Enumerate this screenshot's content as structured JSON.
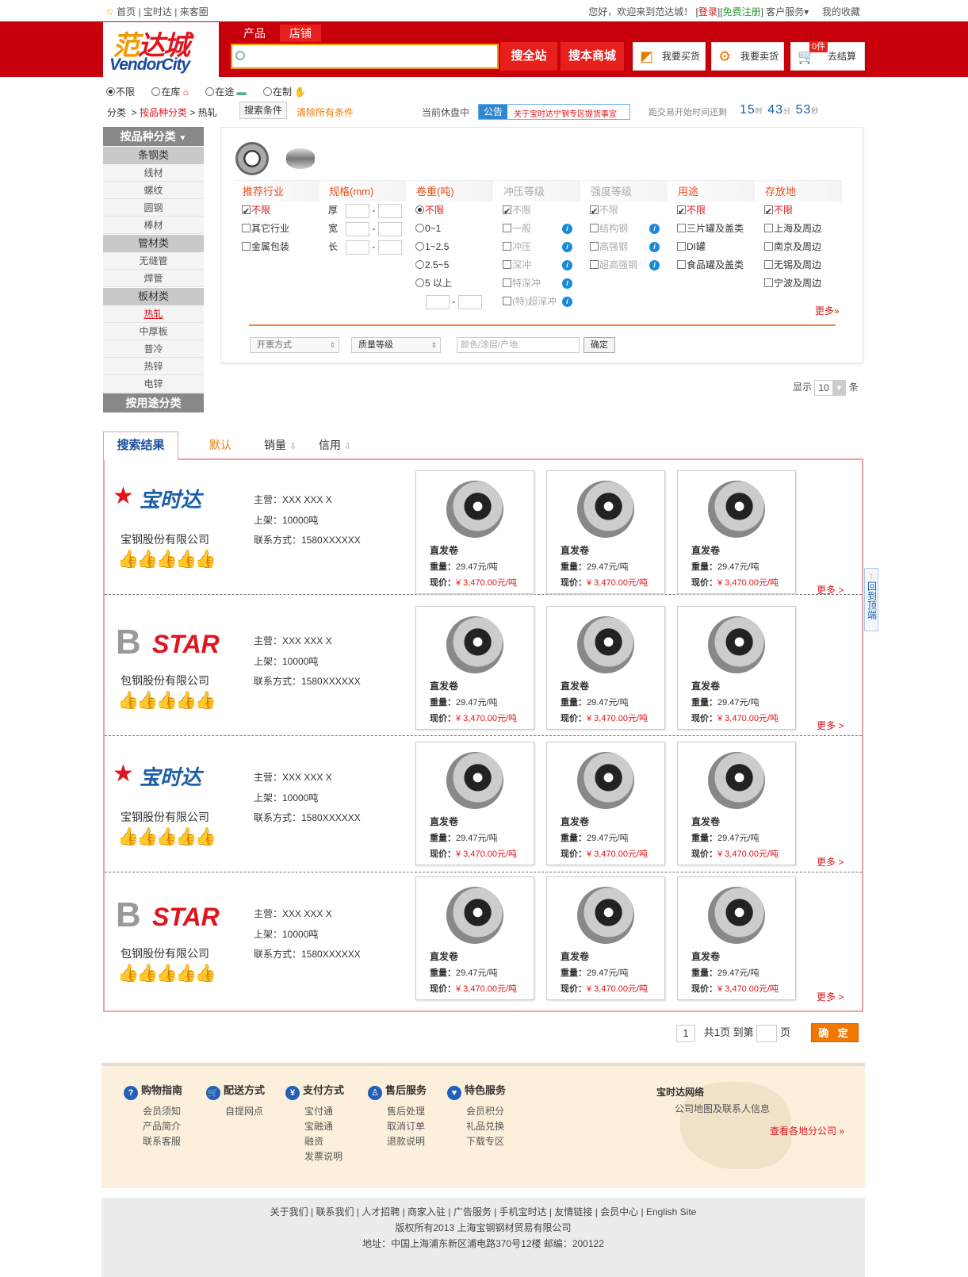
{
  "topbar": {
    "nav": [
      "首页",
      "宝时达",
      "来客圈"
    ],
    "greeting": "您好，欢迎来到范达城！",
    "login": "登录",
    "register": "免费注册",
    "service": "客户服务",
    "favorites": "我的收藏"
  },
  "logo": {
    "cn_left": "范",
    "cn_right": "达城",
    "en": "VendorCity"
  },
  "header": {
    "tabs": [
      "产品",
      "店铺"
    ],
    "search_all": "搜全站",
    "search_mall": "搜本商城",
    "buy": "我要买货",
    "sell": "我要卖货",
    "cart_count": "0件",
    "checkout": "去结算"
  },
  "stock_filter": [
    "不限",
    "在库",
    "在途",
    "在制"
  ],
  "breadcrumb": {
    "root": "分类",
    "level1": "按品种分类",
    "level2": "热轧",
    "cond_button": "搜索条件",
    "clear": "清除所有条件"
  },
  "market": {
    "status": "当前休盘中",
    "notice_tag": "公告",
    "notice_text": "关于宝时达宁钢专区提货事宜",
    "countdown_label": "距交易开始时间还剩",
    "countdown": {
      "d": "15",
      "h": "43",
      "m": "53"
    },
    "units": {
      "d": "时",
      "h": "分",
      "m": "秒"
    }
  },
  "sidebar": {
    "head1": "按品种分类",
    "groups": [
      {
        "title": "条钢类",
        "items": [
          "线材",
          "螺纹",
          "圆钢",
          "棒材"
        ]
      },
      {
        "title": "管材类",
        "items": [
          "无缝管",
          "焊管"
        ]
      },
      {
        "title": "板材类",
        "items": [
          "热轧",
          "中厚板",
          "普冷",
          "热锌",
          "电锌"
        ]
      }
    ],
    "head2": "按用途分类"
  },
  "filters": {
    "industry": {
      "title": "推荐行业",
      "items": [
        "不限",
        "其它行业",
        "金属包装"
      ]
    },
    "spec": {
      "title": "规格(mm)",
      "items": [
        "厚",
        "宽",
        "长"
      ]
    },
    "weight": {
      "title": "卷重(吨)",
      "items": [
        "不限",
        "0~1",
        "1~2.5",
        "2.5~5",
        "5 以上"
      ]
    },
    "stamping": {
      "title": "冲压等级",
      "items": [
        "不限",
        "一般",
        "冲压",
        "深冲",
        "特深冲",
        "(特)超深冲"
      ]
    },
    "strength": {
      "title": "强度等级",
      "items": [
        "不限",
        "结构钢",
        "高强钢",
        "超高强钢"
      ]
    },
    "usage": {
      "title": "用途",
      "items": [
        "不限",
        "三片罐及盖类",
        "DI罐",
        "食品罐及盖类"
      ]
    },
    "storage": {
      "title": "存放地",
      "items": [
        "不限",
        "上海及周边",
        "南京及周边",
        "无锡及周边",
        "宁波及周边"
      ]
    },
    "more": "更多»",
    "invoice": "开票方式",
    "quality": "质量等级",
    "attrs_placeholder": "颜色/涂层/产地",
    "ok": "确定"
  },
  "show": {
    "label": "显示",
    "value": "10",
    "unit": "条"
  },
  "results": {
    "tab": "搜索结果",
    "sorts": [
      "默认",
      "销量",
      "信用"
    ],
    "rows": [
      {
        "logo": "宝时达",
        "company": "宝钢股份有限公司",
        "main": "主营：XXX  XXX    X",
        "listed": "上架：10000吨",
        "contact": "联系方式：1580XXXXXX"
      },
      {
        "logo": "STAR",
        "company": "包钢股份有限公司",
        "main": "主营：XXX  XXX    X",
        "listed": "上架：10000吨",
        "contact": "联系方式：1580XXXXXX"
      },
      {
        "logo": "宝时达",
        "company": "宝钢股份有限公司",
        "main": "主营：XXX  XXX    X",
        "listed": "上架：10000吨",
        "contact": "联系方式：1580XXXXXX"
      },
      {
        "logo": "STAR",
        "company": "包钢股份有限公司",
        "main": "主营：XXX  XXX    X",
        "listed": "上架：10000吨",
        "contact": "联系方式：1580XXXXXX"
      }
    ],
    "product": {
      "name": "直发卷",
      "weight_label": "重量：",
      "weight": "29.47元/吨",
      "price_label": "现价：",
      "price": "¥ 3,470.00元/吨"
    },
    "more": "更多 >"
  },
  "backtop": "回到顶端",
  "pager": {
    "page": "1",
    "total": "共1页 到第",
    "unit": "页",
    "ok": "确 定"
  },
  "footer": {
    "cols": [
      {
        "title": "购物指南",
        "items": [
          "会员须知",
          "产品简介",
          "联系客服"
        ]
      },
      {
        "title": "配送方式",
        "items": [
          "自提网点"
        ]
      },
      {
        "title": "支付方式",
        "items": [
          "宝付通",
          "宝融通",
          "融资",
          "发票说明"
        ]
      },
      {
        "title": "售后服务",
        "items": [
          "售后处理",
          "取消订单",
          "退款说明"
        ]
      },
      {
        "title": "特色服务",
        "items": [
          "会员积分",
          "礼品兑换",
          "下载专区"
        ]
      }
    ],
    "network": "宝时达网络",
    "map_info": "公司地图及联系人信息",
    "branches": "查看各地分公司 »",
    "links": "关于我们 | 联系我们 | 人才招聘 | 商家入驻 | 广告服务 | 手机宝时达 | 友情链接 | 会员中心 | English Site",
    "copyright": "版权所有2013 上海宝钢钢材贸易有限公司",
    "address": "地址：中国上海浦东新区浦电路370号12楼 邮编：200122"
  },
  "colors": {
    "brand_red": "#c8000b",
    "accent_orange": "#f07800",
    "blue": "#1a4c9c"
  }
}
